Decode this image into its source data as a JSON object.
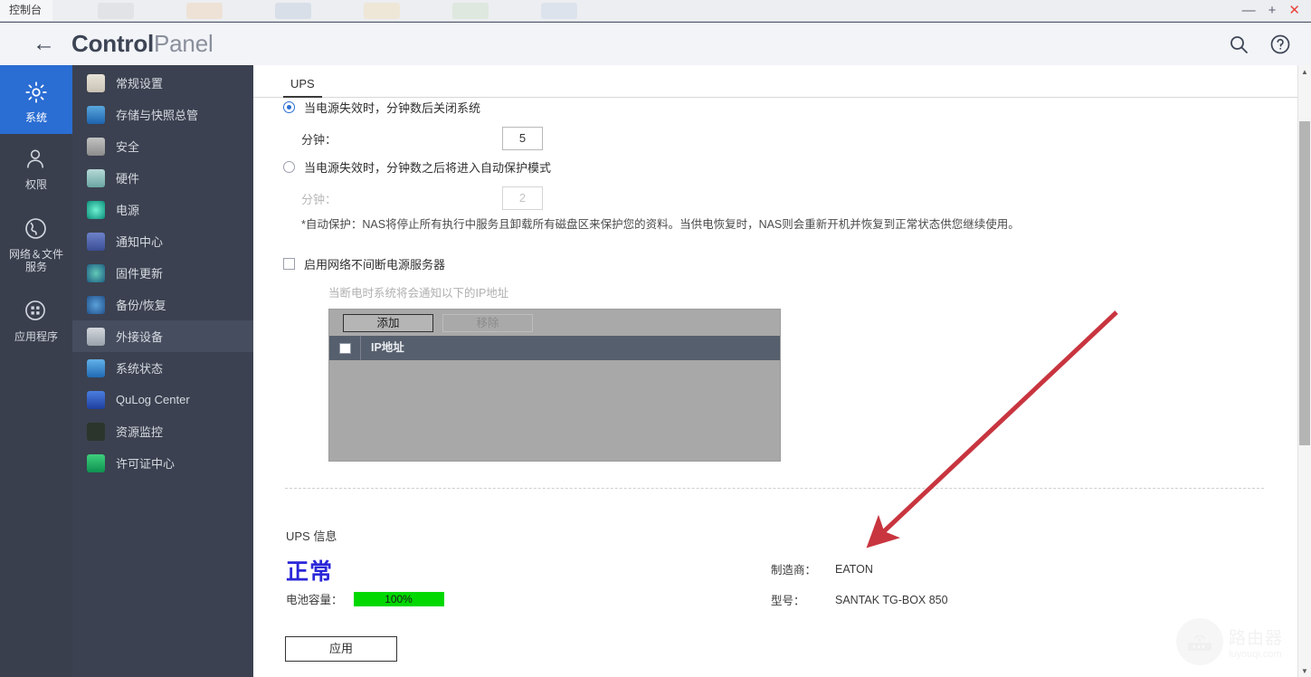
{
  "os_bar": {
    "tab_label": "控制台",
    "minimize": "—",
    "maximize": "+",
    "close": "✕"
  },
  "header": {
    "back_icon": "←",
    "title_bold": "Control",
    "title_light": "Panel",
    "search_icon": "search-icon",
    "help_icon": "help-icon"
  },
  "rail": {
    "items": [
      {
        "label": "系统",
        "icon": "gear-icon",
        "active": true
      },
      {
        "label": "权限",
        "icon": "user-icon",
        "active": false
      },
      {
        "label": "网络＆文件\n服务",
        "icon": "globe-icon",
        "active": false
      },
      {
        "label": "应用程序",
        "icon": "grid-icon",
        "active": false
      }
    ]
  },
  "menu": {
    "items": [
      {
        "label": "常规设置",
        "icon": "clipboard-icon",
        "color": "#c9c4bb",
        "active": false
      },
      {
        "label": "存储与快照总管",
        "icon": "storage-icon",
        "color": "#2e7fc4",
        "active": false
      },
      {
        "label": "安全",
        "icon": "lock-icon",
        "color": "#9a9a9a",
        "active": false
      },
      {
        "label": "硬件",
        "icon": "hardware-icon",
        "color": "#7fb7b5",
        "active": false
      },
      {
        "label": "电源",
        "icon": "power-icon",
        "color": "#18a58f",
        "active": false
      },
      {
        "label": "通知中心",
        "icon": "bell-icon",
        "color": "#4a63a8",
        "active": false
      },
      {
        "label": "固件更新",
        "icon": "firmware-icon",
        "color": "#2d6e8f",
        "active": false
      },
      {
        "label": "备份/恢复",
        "icon": "backup-icon",
        "color": "#2f6fa8",
        "active": false
      },
      {
        "label": "外接设备",
        "icon": "external-device-icon",
        "color": "#b9bdc4",
        "active": true
      },
      {
        "label": "系统状态",
        "icon": "monitor-icon",
        "color": "#2f7fc7",
        "active": false
      },
      {
        "label": "QuLog Center",
        "icon": "qulog-icon",
        "color": "#2a5fc7",
        "active": false
      },
      {
        "label": "资源监控",
        "icon": "resource-monitor-icon",
        "color": "#2c3a2c",
        "active": false
      },
      {
        "label": "许可证中心",
        "icon": "license-icon",
        "color": "#1aa85a",
        "active": false
      }
    ]
  },
  "content": {
    "tab_label": "UPS",
    "option1": {
      "label": "当电源失效时，分钟数后关闭系统",
      "selected": true,
      "field_label": "分钟：",
      "value": "5"
    },
    "option2": {
      "label": "当电源失效时，分钟数之后将进入自动保护模式",
      "selected": false,
      "field_label": "分钟：",
      "value": "2"
    },
    "note": "*自动保护：NAS将停止所有执行中服务且卸载所有磁盘区来保护您的资料。当供电恢复时，NAS则会重新开机并恢复到正常状态供您继续使用。",
    "network_ups": {
      "checkbox_label": "启用网络不间断电源服务器",
      "checked": false,
      "hint": "当断电时系统将会通知以下的IP地址",
      "add_button": "添加",
      "remove_button": "移除",
      "column_header": "IP地址",
      "rows": []
    },
    "ups_info": {
      "section_title": "UPS 信息",
      "status": "正常",
      "status_color": "#2b27d8",
      "battery_label": "电池容量：",
      "battery_percent": "100%",
      "battery_value": 100,
      "battery_color": "#00d800",
      "manufacturer_label": "制造商：",
      "manufacturer_value": "EATON",
      "model_label": "型号：",
      "model_value": "SANTAK TG-BOX 850"
    },
    "apply_button": "应用"
  },
  "scrollbar": {
    "up_arrow": "▲",
    "down_arrow": "▼"
  },
  "watermark": {
    "cn": "路由器",
    "en": "luyouqi.com"
  }
}
